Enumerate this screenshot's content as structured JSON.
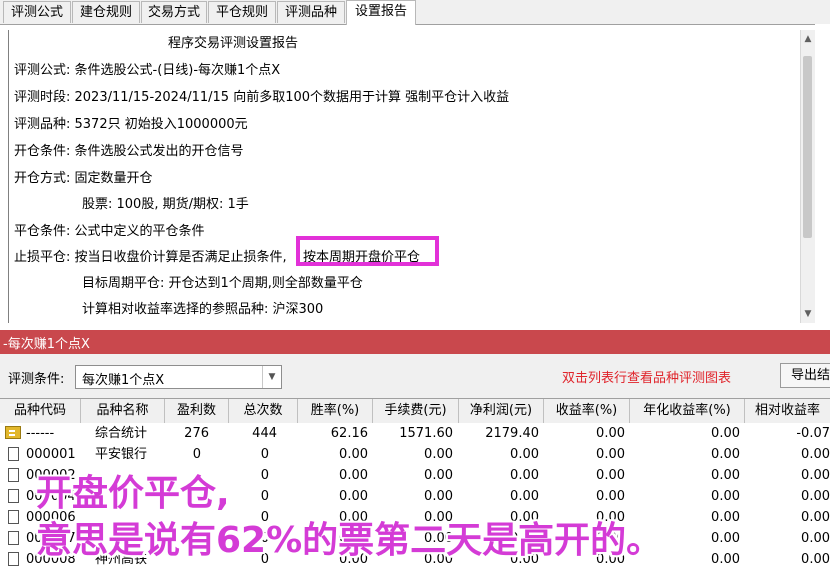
{
  "tabs": [
    {
      "label": "评测公式"
    },
    {
      "label": "建仓规则"
    },
    {
      "label": "交易方式"
    },
    {
      "label": "平仓规则"
    },
    {
      "label": "评测品种"
    },
    {
      "label": "设置报告"
    }
  ],
  "report": {
    "title": "程序交易评测设置报告",
    "formula": "评测公式: 条件选股公式-(日线)-每次赚1个点X",
    "period": "评测时段: 2023/11/15-2024/11/15 向前多取100个数据用于计算 强制平仓计入收益",
    "varieties": "评测品种: 5372只 初始投入1000000元",
    "open_cond": "开仓条件: 条件选股公式发出的开仓信号",
    "open_mode": "开仓方式: 固定数量开仓",
    "open_qty": "股票: 100股, 期货/期权: 1手",
    "close_cond": "平仓条件: 公式中定义的平仓条件",
    "stop_loss_a": "止损平仓: 按当日收盘价计算是否满足止损条件,",
    "stop_loss_b": "按本周期开盘价平仓",
    "target_close": "目标周期平仓: 开仓达到1个周期,则全部数量平仓",
    "benchmark": "计算相对收益率选择的参照品种: 沪深300"
  },
  "panel_title": "-每次赚1个点X",
  "condition": {
    "label": "评测条件:",
    "value": "每次赚1个点X"
  },
  "hint": "双击列表行查看品种评测图表",
  "export_label": "导出结",
  "table": {
    "headers": [
      "品种代码",
      "品种名称",
      "盈利数",
      "总次数",
      "胜率(%)",
      "手续费(元)",
      "净利润(元)",
      "收益率(%)",
      "年化收益率(%)",
      "相对收益率"
    ],
    "rows": [
      [
        "------",
        "综合统计",
        "276",
        "444",
        "62.16",
        "1571.60",
        "2179.40",
        "0.00",
        "0.00",
        "-0.07"
      ],
      [
        "000001",
        "平安银行",
        "0",
        "0",
        "0.00",
        "0.00",
        "0.00",
        "0.00",
        "0.00",
        "0.00"
      ],
      [
        "000002",
        "",
        "",
        "0",
        "0.00",
        "0.00",
        "0.00",
        "0.00",
        "0.00",
        "0.00"
      ],
      [
        "000004",
        "",
        "",
        "0",
        "0.00",
        "0.00",
        "0.00",
        "0.00",
        "0.00",
        "0.00"
      ],
      [
        "000006",
        "",
        "",
        "0",
        "0.00",
        "0.00",
        "0.00",
        "0.00",
        "0.00",
        "0.00"
      ],
      [
        "000007",
        "",
        "",
        "0",
        "0.00",
        "0.00",
        "0.00",
        "0.00",
        "0.00",
        "0.00"
      ],
      [
        "000008",
        "神州高铁",
        "",
        "0",
        "0.00",
        "0.00",
        "0.00",
        "0.00",
        "0.00",
        "0.00"
      ]
    ]
  },
  "overlay": {
    "line1": "开盘价平仓,",
    "line2": "意思是说有62%的票第二天是高开的。"
  },
  "colors": {
    "accent_bar": "#c9484d",
    "highlight": "#e231d8",
    "hint_red": "#e0242b"
  }
}
